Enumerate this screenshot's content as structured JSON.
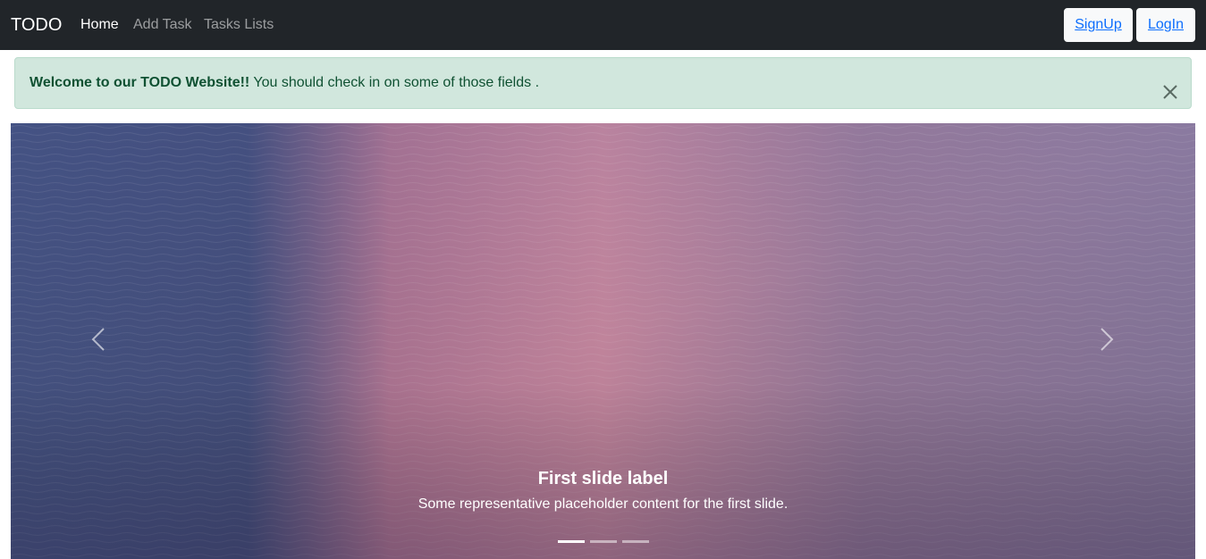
{
  "navbar": {
    "brand": "TODO",
    "links": [
      {
        "label": "Home",
        "active": true
      },
      {
        "label": "Add Task",
        "active": false
      },
      {
        "label": "Tasks Lists",
        "active": false
      }
    ],
    "signup_label": "SignUp",
    "login_label": "LogIn"
  },
  "alert": {
    "strong_text": "Welcome to our TODO Website!!",
    "message": " You should check in on some of those fields ."
  },
  "carousel": {
    "caption_title": "First slide label",
    "caption_text": "Some representative placeholder content for the first slide.",
    "active_slide": 1,
    "slide_count": 3
  },
  "icons": {
    "close": "close-icon",
    "prev": "chevron-left-icon",
    "next": "chevron-right-icon"
  },
  "colors": {
    "navbar_bg": "#212529",
    "alert_bg": "#d1e7dd",
    "alert_text": "#0f5132",
    "link_blue": "#0d6efd"
  }
}
